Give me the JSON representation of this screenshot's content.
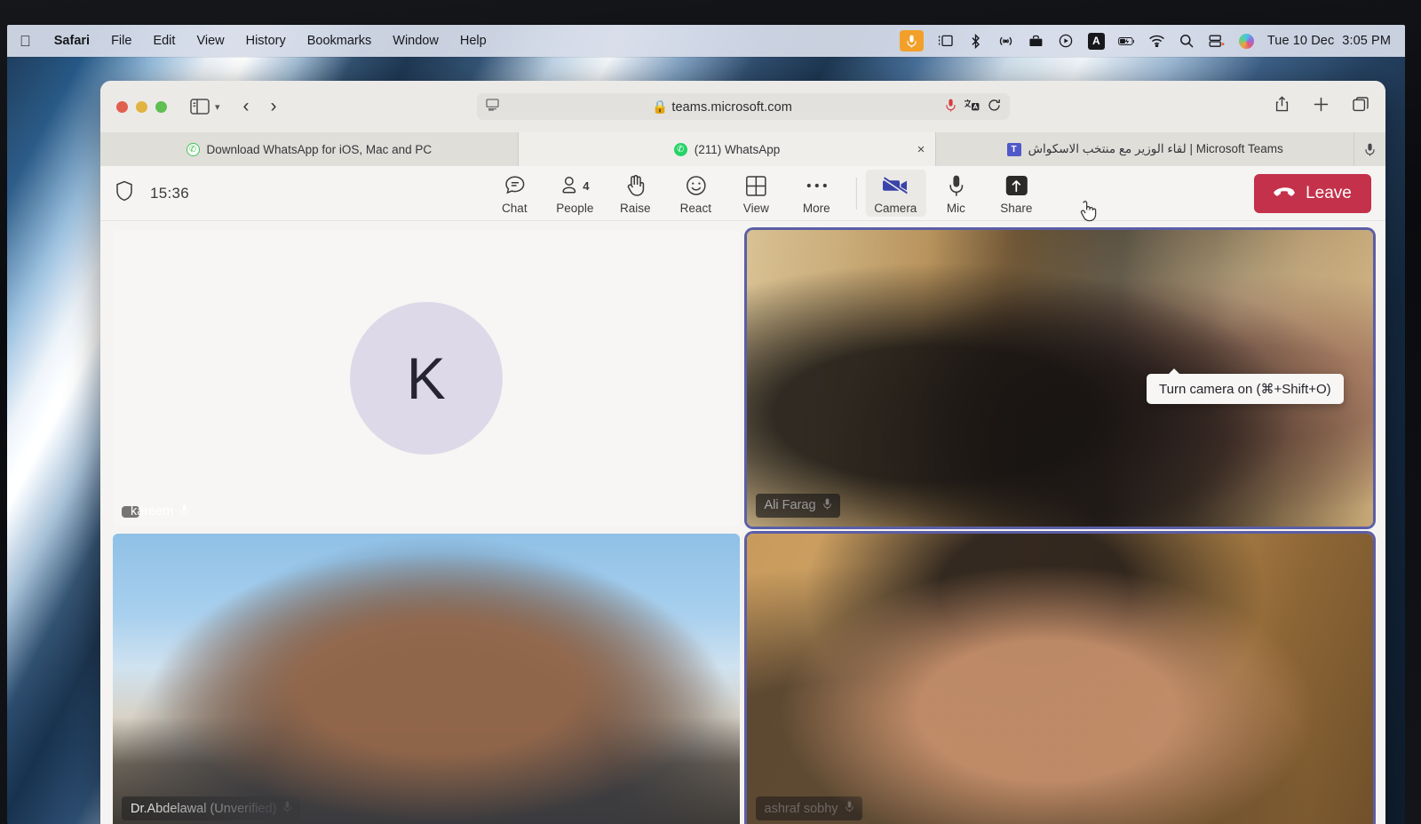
{
  "menubar": {
    "apple_logo": "apple-logo",
    "items": [
      {
        "label": "Safari",
        "bold": true
      },
      {
        "label": "File",
        "bold": false
      },
      {
        "label": "Edit",
        "bold": false
      },
      {
        "label": "View",
        "bold": false
      },
      {
        "label": "History",
        "bold": false
      },
      {
        "label": "Bookmarks",
        "bold": false
      },
      {
        "label": "Window",
        "bold": false
      },
      {
        "label": "Help",
        "bold": false
      }
    ],
    "status_icons": [
      "microphone-active-icon",
      "screen-mirroring-icon",
      "bluetooth-icon",
      "airdrop-icon",
      "briefcase-icon",
      "now-playing-icon",
      "input-source-A-icon",
      "battery-charging-icon",
      "wifi-icon",
      "spotlight-search-icon",
      "control-center-icon",
      "siri-icon"
    ],
    "date": "Tue 10 Dec",
    "time": "3:05 PM"
  },
  "browser": {
    "window_controls": [
      "close",
      "minimize",
      "zoom"
    ],
    "sidebar_icon": "sidebar-toggle-icon",
    "back_icon": "chevron-left-icon",
    "forward_icon": "chevron-right-icon",
    "address": {
      "reader_icon": "reader-view-icon",
      "lock_icon": "lock-icon",
      "url": "teams.microsoft.com",
      "mic_icon": "microphone-in-use-icon",
      "extension_icon": "extension-icon",
      "reload_icon": "reload-icon"
    },
    "toolbar_right": [
      "share-icon",
      "new-tab-icon",
      "tab-overview-icon"
    ],
    "tabs": [
      {
        "title": "Download WhatsApp for iOS, Mac and PC",
        "icon": "whatsapp-outline-icon",
        "active": false,
        "closable": false
      },
      {
        "title": "(211) WhatsApp",
        "icon": "whatsapp-icon",
        "active": true,
        "closable": true,
        "close_label": "×"
      },
      {
        "title": "لقاء الوزير مع منتخب الاسكواش | Microsoft Teams",
        "icon": "microsoft-teams-icon",
        "active": false,
        "closable": false
      }
    ],
    "tabbar_mic_icon": "microphone-icon"
  },
  "teams": {
    "shield_icon": "shield-icon",
    "meeting_timer": "15:36",
    "toolbar": [
      {
        "name": "chat",
        "label": "Chat",
        "icon": "chat-icon"
      },
      {
        "name": "people",
        "label": "People",
        "icon": "people-icon",
        "badge": "4"
      },
      {
        "name": "raise",
        "label": "Raise",
        "icon": "raise-hand-icon"
      },
      {
        "name": "react",
        "label": "React",
        "icon": "react-smiley-icon"
      },
      {
        "name": "view",
        "label": "View",
        "icon": "view-grid-icon"
      },
      {
        "name": "more",
        "label": "More",
        "icon": "more-ellipsis-icon"
      },
      {
        "name": "camera",
        "label": "Camera",
        "icon": "camera-off-icon",
        "state": "off",
        "active_hover": true
      },
      {
        "name": "mic",
        "label": "Mic",
        "icon": "microphone-icon"
      },
      {
        "name": "share",
        "label": "Share",
        "icon": "share-screen-icon"
      }
    ],
    "leave": {
      "label": "Leave",
      "icon": "hangup-phone-icon",
      "color": "#c4314b"
    },
    "tooltip": "Turn camera on (⌘+Shift+O)",
    "participants": [
      {
        "name": "kareem",
        "type": "avatar",
        "avatar_letter": "K",
        "avatar_color": "#ded9e8",
        "mic_icon": "microphone-icon",
        "speaking": false
      },
      {
        "name": "Ali Farag",
        "type": "video",
        "mic_icon": "microphone-icon",
        "speaking": true
      },
      {
        "name": "Dr.Abdelawal (Unverified)",
        "type": "video",
        "mic_icon": "microphone-icon",
        "speaking": false
      },
      {
        "name": "ashraf sobhy",
        "type": "video",
        "mic_icon": "microphone-icon",
        "speaking": true
      }
    ]
  }
}
